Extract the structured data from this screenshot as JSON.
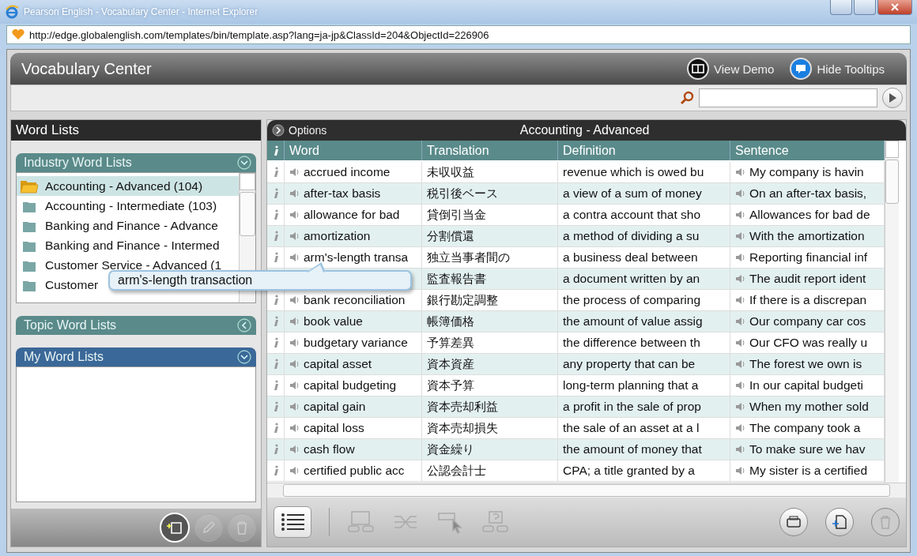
{
  "browser": {
    "title": "Pearson English - Vocabulary Center - Internet Explorer",
    "url": "http://edge.globalenglish.com/templates/bin/template.asp?lang=ja-jp&ClassId=204&ObjectId=226906"
  },
  "app": {
    "title": "Vocabulary Center",
    "view_demo": "View Demo",
    "hide_tooltips": "Hide Tooltips"
  },
  "word_lists": {
    "title": "Word Lists",
    "sections": [
      {
        "title": "Industry Word Lists",
        "kind": "shared",
        "expanded": true,
        "items": [
          {
            "label": "Accounting - Advanced (104)",
            "selected": true
          },
          {
            "label": "Accounting - Intermediate (103)",
            "selected": false
          },
          {
            "label": "Banking and Finance - Advance",
            "selected": false
          },
          {
            "label": "Banking and Finance - Intermed",
            "selected": false
          },
          {
            "label": "Customer Service - Advanced (1",
            "selected": false
          },
          {
            "label": "Customer",
            "selected": false
          }
        ]
      },
      {
        "title": "Topic Word Lists",
        "kind": "shared",
        "expanded": false
      },
      {
        "title": "My Word Lists",
        "kind": "custom",
        "expanded": true
      }
    ]
  },
  "table": {
    "options": "Options",
    "title": "Accounting - Advanced",
    "columns": [
      "Word",
      "Translation",
      "Definition",
      "Sentence"
    ],
    "rows": [
      {
        "word": "accrued income",
        "translation": "未収収益",
        "definition": "revenue which is owed bu",
        "sentence": "My company is havin"
      },
      {
        "word": "after-tax basis",
        "translation": "税引後ベース",
        "definition": "a view of a sum of money",
        "sentence": "On an after-tax basis,"
      },
      {
        "word": "allowance for bad",
        "translation": "貸倒引当金",
        "definition": "a contra account that sho",
        "sentence": "Allowances for bad de"
      },
      {
        "word": "amortization",
        "translation": "分割償還",
        "definition": "a method of dividing a su",
        "sentence": "With the amortization"
      },
      {
        "word": "arm's-length transa",
        "translation": "独立当事者間の",
        "definition": "a business deal between",
        "sentence": "Reporting financial inf"
      },
      {
        "translation": "監査報告書",
        "definition": "a document written by an",
        "sentence": "The audit report ident"
      },
      {
        "word": "bank reconciliation",
        "translation": "銀行勘定調整",
        "definition": "the process of comparing",
        "sentence": "If there is a discrepan"
      },
      {
        "word": "book value",
        "translation": "帳簿価格",
        "definition": "the amount of value assig",
        "sentence": "Our company car cos"
      },
      {
        "word": "budgetary variance",
        "translation": "予算差異",
        "definition": "the difference between th",
        "sentence": "Our CFO was really u"
      },
      {
        "word": "capital asset",
        "translation": "資本資産",
        "definition": "any property that can be",
        "sentence": "The forest we own is"
      },
      {
        "word": "capital budgeting",
        "translation": "資本予算",
        "definition": "long-term planning that a",
        "sentence": "In our capital budgeti"
      },
      {
        "word": "capital gain",
        "translation": "資本売却利益",
        "definition": "a profit in the sale of prop",
        "sentence": "When my mother sold"
      },
      {
        "word": "capital loss",
        "translation": "資本売却損失",
        "definition": "the sale of an asset at a l",
        "sentence": "The company took a"
      },
      {
        "word": "cash flow",
        "translation": "資金繰り",
        "definition": "the amount of money that",
        "sentence": "To make sure we hav"
      },
      {
        "word": "certified public acc",
        "translation": "公認会計士",
        "definition": "CPA; a title granted by a",
        "sentence": "My sister is a certified"
      }
    ]
  },
  "tooltip": {
    "text": "arm's-length transaction"
  }
}
